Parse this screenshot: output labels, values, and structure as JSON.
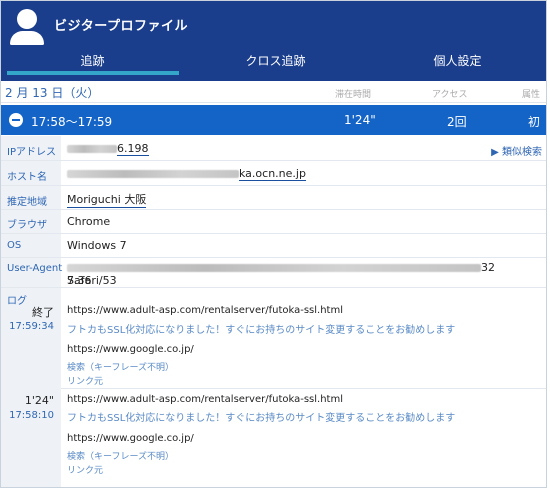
{
  "app": {
    "title": "ビジタープロファイル"
  },
  "tabs": [
    "追跡",
    "クロス追跡",
    "個人設定"
  ],
  "date_row": {
    "date": "2 月 13 日（火）",
    "columns": [
      "滞在時間",
      "アクセス",
      "属性"
    ]
  },
  "session": {
    "range": "17:58〜17:59",
    "duration": "1'24\"",
    "count": "2回",
    "flag": "初"
  },
  "details": {
    "ip": {
      "label": "IPアドレス",
      "value": "6.198",
      "similar": "▶ 類似検索"
    },
    "host": {
      "label": "ホスト名",
      "value": "ka.ocn.ne.jp"
    },
    "region": {
      "label": "推定地域",
      "value": "Moriguchi 大阪"
    },
    "browser": {
      "label": "ブラウザ",
      "value": "Chrome"
    },
    "os": {
      "label": "OS",
      "value": "Windows 7"
    },
    "ua": {
      "label": "User-Agent",
      "value_end": "32 Safari/53",
      "value_line2": "7.36"
    }
  },
  "log": {
    "label": "ログ",
    "entries": [
      {
        "status": "終了",
        "time": "17:59:34",
        "url": "https://www.adult-asp.com/rentalserver/futoka-ssl.html",
        "message": "フトカもSSL化対応になりました！すぐにお持ちのサイト変更することをお勧めします",
        "ref_url": "https://www.google.co.jp/",
        "ref_search": "検索（キーフレーズ不明）",
        "ref_link": "リンク元"
      },
      {
        "status": "1'24\"",
        "time": "17:58:10",
        "url": "https://www.adult-asp.com/rentalserver/futoka-ssl.html",
        "message": "フトカもSSL化対応になりました！すぐにお持ちのサイト変更することをお勧めします",
        "ref_url": "https://www.google.co.jp/",
        "ref_search": "検索（キーフレーズ不明）",
        "ref_link": "リンク元"
      }
    ]
  }
}
